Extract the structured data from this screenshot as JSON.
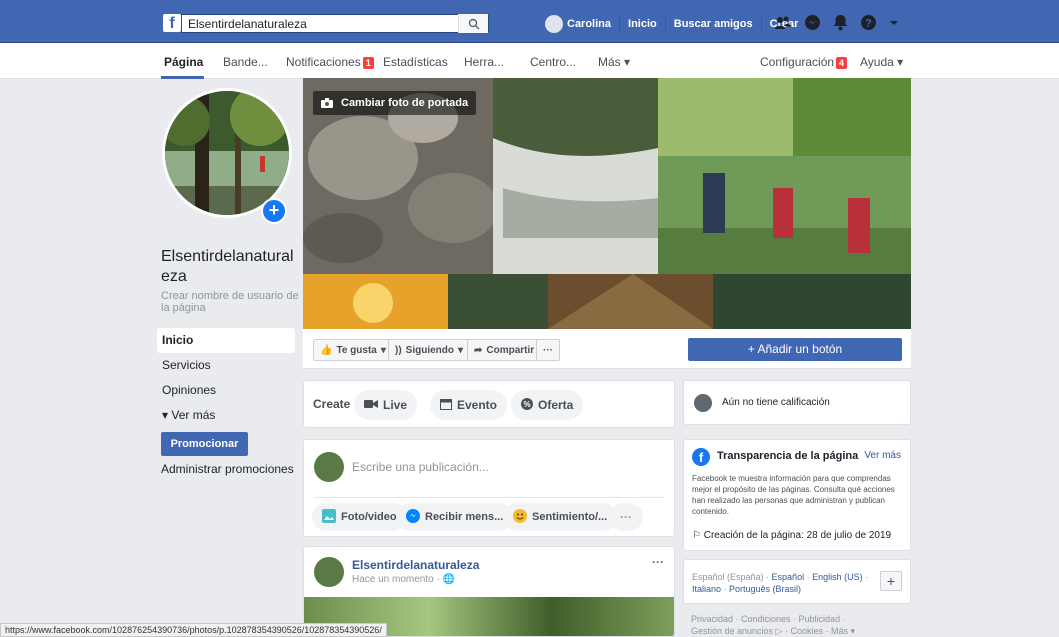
{
  "topbar": {
    "search_value": "Elsentirdelanaturaleza",
    "user_name": "Carolina",
    "nav_links": [
      "Inicio",
      "Buscar amigos",
      "Crear"
    ]
  },
  "pagebar": {
    "tabs": [
      "Página",
      "Bande...",
      "Notificaciones",
      "Estadísticas",
      "Herra...",
      "Centro...",
      "Más ▾"
    ],
    "notifications_badge": "1",
    "config_label": "Configuración",
    "config_badge": "4",
    "help_label": "Ayuda ▾"
  },
  "profile": {
    "page_name": "Elsentirdelanaturaleza",
    "username_prompt": "Crear nombre de usuario de la página",
    "menu": [
      "Inicio",
      "Servicios",
      "Opiniones"
    ],
    "ver_mas": "Ver más",
    "promote": "Promocionar",
    "manage_promotions": "Administrar promociones"
  },
  "cover": {
    "change_cover": "Cambiar foto de portada"
  },
  "actions": {
    "like": "Te gusta",
    "following": "Siguiendo",
    "share": "Compartir",
    "more": "···",
    "add_button": "+ Añadir un botón"
  },
  "create": {
    "label": "Create",
    "live": "Live",
    "event": "Evento",
    "offer": "Oferta"
  },
  "composer": {
    "placeholder": "Escribe una publicación...",
    "photo": "Foto/video",
    "message": "Recibir mens...",
    "feeling": "Sentimiento/...",
    "more": "···"
  },
  "post": {
    "author": "Elsentirdelanaturaleza",
    "time": "Hace un momento ·",
    "more": "···"
  },
  "rating": {
    "text": "Aún no tiene calificación"
  },
  "transparency": {
    "title": "Transparencia de la página",
    "see_more": "Ver más",
    "body": "Facebook te muestra información para que comprendas mejor el propósito de las páginas. Consulta qué acciones han realizado las personas que administran y publican contenido.",
    "created": "Creación de la página: 28 de julio de 2019"
  },
  "languages": {
    "current": "Español (España)",
    "others": [
      "Español",
      "English (US)",
      "Italiano",
      "Português (Brasil)"
    ]
  },
  "footer": {
    "line1": "Privacidad · Condiciones · Publicidad ·",
    "line2": "Gestión de anuncios ▷ · Cookies · Más ▾"
  },
  "status_url": "https://www.facebook.com/102876254390736/photos/p.102878354390526/102878354390526/",
  "colors": {
    "brand": "#4267b2",
    "badge": "#fa3e3e"
  }
}
